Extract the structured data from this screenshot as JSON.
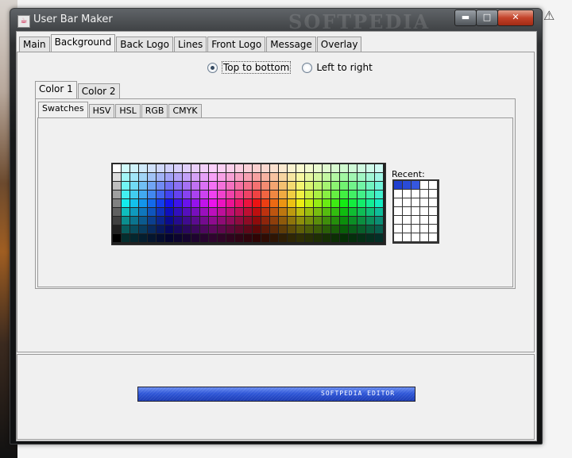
{
  "window": {
    "title": "User Bar Maker",
    "watermark": "SOFTPEDIA"
  },
  "main_tabs": [
    "Main",
    "Background",
    "Back Logo",
    "Lines",
    "Front Logo",
    "Message",
    "Overlay"
  ],
  "active_main_tab": "Background",
  "direction": {
    "option1": "Top to bottom",
    "option2": "Left to right",
    "selected": "Top to bottom"
  },
  "color_tabs": [
    "Color 1",
    "Color 2"
  ],
  "active_color_tab": "Color 1",
  "chooser_tabs": [
    "Swatches",
    "HSV",
    "HSL",
    "RGB",
    "CMYK"
  ],
  "active_chooser_tab": "Swatches",
  "recent_label": "Recent:",
  "recent_colors": [
    "#1f3fd0",
    "#2a4bd8",
    "#3557df"
  ],
  "userbar_text": "SOFTPEDIA EDITOR",
  "icons": {
    "app": "java-cup-icon",
    "minimize": "minimize-icon",
    "maximize": "maximize-icon",
    "close": "close-icon",
    "warning": "warning-icon"
  }
}
